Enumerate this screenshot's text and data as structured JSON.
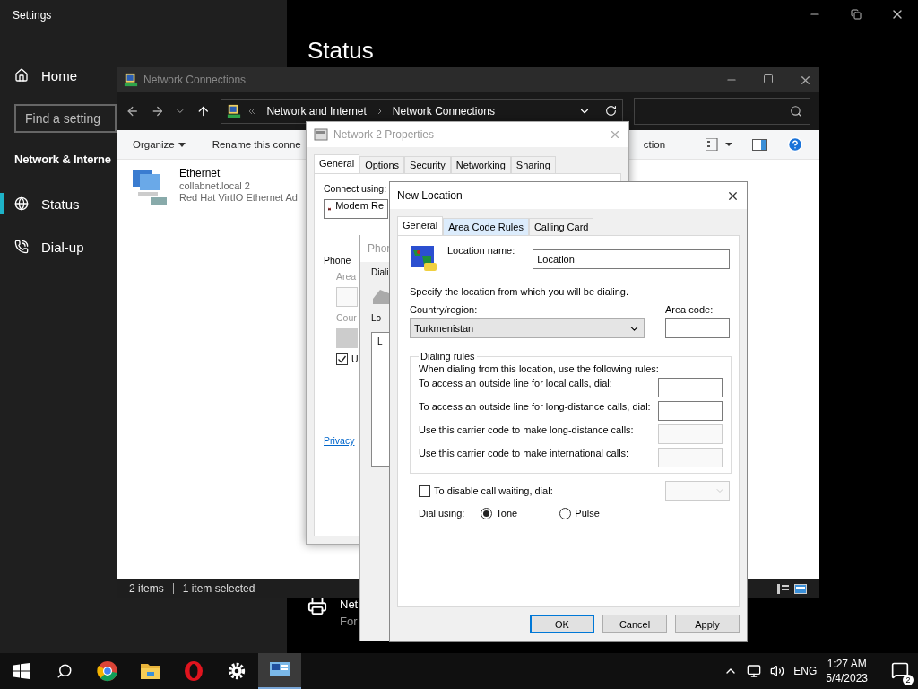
{
  "settings": {
    "title": "Settings",
    "home": "Home",
    "search": {
      "placeholder": "Find a setting"
    },
    "section": "Network & Interne",
    "items": [
      {
        "label": "Status",
        "kind": "globe",
        "selected": true
      },
      {
        "label": "Dial-up",
        "kind": "phone",
        "selected": false
      }
    ],
    "page_title": "Status",
    "related": {
      "title": "Net",
      "subtitle": "For"
    }
  },
  "network_connections": {
    "title": "Network Connections",
    "crumbs": [
      "Network and Internet",
      "Network Connections"
    ],
    "toolbar": [
      "Organize",
      "Rename this conne",
      "ction"
    ],
    "items": [
      {
        "name": "Ethernet",
        "network": "collabnet.local 2",
        "adapter": "Red Hat VirtIO Ethernet Ad"
      }
    ],
    "status_bar": [
      "2 items",
      "1 item selected"
    ]
  },
  "properties": {
    "title": "Network 2 Properties",
    "tabs": [
      {
        "label": "General",
        "selected": true
      },
      {
        "label": "Options",
        "selected": false
      },
      {
        "label": "Security",
        "selected": false
      },
      {
        "label": "Networking",
        "selected": false
      },
      {
        "label": "Sharing",
        "selected": false
      }
    ],
    "connect_label": "Connect using:",
    "device": "Modem Re",
    "group": "Phone",
    "area_label": "Area",
    "country_label": "Cour",
    "use_rules": {
      "label": "U",
      "checked": true
    },
    "privacy_link": "Privacy"
  },
  "phone_dialog": {
    "title": "Phor",
    "tab": "Diali",
    "locations_label": "Lo",
    "list_header": "L"
  },
  "new_location": {
    "title": "New Location",
    "tabs": [
      {
        "label": "General",
        "selected": true
      },
      {
        "label": "Area Code Rules",
        "selected": false
      },
      {
        "label": "Calling Card",
        "selected": false
      }
    ],
    "location_name_label": "Location name:",
    "location_name": "Location",
    "instruction": "Specify the location from which you will be dialing.",
    "country_label": "Country/region:",
    "country": "Turkmenistan",
    "area_code_label": "Area code:",
    "rules": {
      "title": "Dialing rules",
      "intro": "When dialing from this location, use the following rules:",
      "fields": [
        {
          "label": "To access an outside line for local calls, dial:",
          "disabled": false
        },
        {
          "label": "To access an outside line for long-distance calls, dial:",
          "disabled": false
        },
        {
          "label": "Use this carrier code to make long-distance calls:",
          "disabled": true
        },
        {
          "label": "Use this carrier code to make international calls:",
          "disabled": true
        }
      ]
    },
    "call_waiting": {
      "label": "To disable call waiting, dial:",
      "checked": false
    },
    "dial_using": {
      "label": "Dial using:",
      "options": [
        {
          "label": "Tone",
          "selected": true
        },
        {
          "label": "Pulse",
          "selected": false
        }
      ]
    },
    "buttons": [
      {
        "label": "OK",
        "default": true
      },
      {
        "label": "Cancel",
        "default": false
      },
      {
        "label": "Apply",
        "default": false
      }
    ]
  },
  "taskbar": {
    "apps": [
      {
        "kind": "chrome",
        "selected": false
      },
      {
        "kind": "folder",
        "selected": false
      },
      {
        "kind": "opera",
        "selected": false
      },
      {
        "kind": "gear",
        "selected": false
      },
      {
        "kind": "network",
        "selected": true
      }
    ],
    "language": "ENG",
    "time": "1:27 AM",
    "date": "5/4/2023",
    "notifications": "2"
  }
}
